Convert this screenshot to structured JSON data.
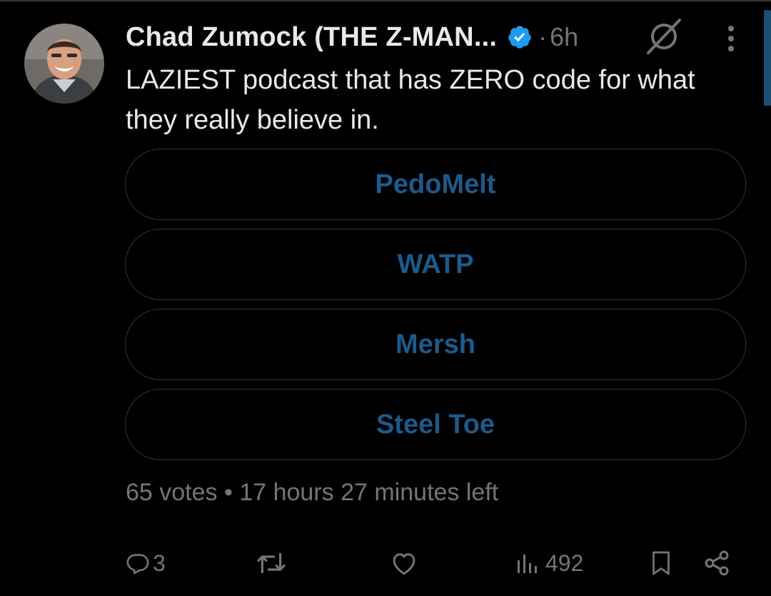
{
  "tweet": {
    "author": {
      "display_name": "Chad Zumock (THE Z-MAN...",
      "verified": true,
      "avatar_icon": "person-avatar"
    },
    "separator": "·",
    "timestamp": "6h",
    "text": "LAZIEST podcast that has ZERO code for what they really believe in."
  },
  "poll": {
    "options": [
      {
        "label": "PedoMelt"
      },
      {
        "label": "WATP"
      },
      {
        "label": "Mersh"
      },
      {
        "label": "Steel Toe"
      }
    ],
    "votes": "65 votes",
    "meta_separator": "•",
    "time_left": "17 hours 27 minutes left"
  },
  "actions": {
    "replies": "3",
    "reposts": "",
    "likes": "",
    "views": "492"
  },
  "colors": {
    "background": "#000000",
    "text": "#e7e9ea",
    "secondary_text": "#71767b",
    "poll_text": "#1d5a8a",
    "poll_border": "#1e3a52",
    "verified_badge": "#1d9bf0"
  }
}
